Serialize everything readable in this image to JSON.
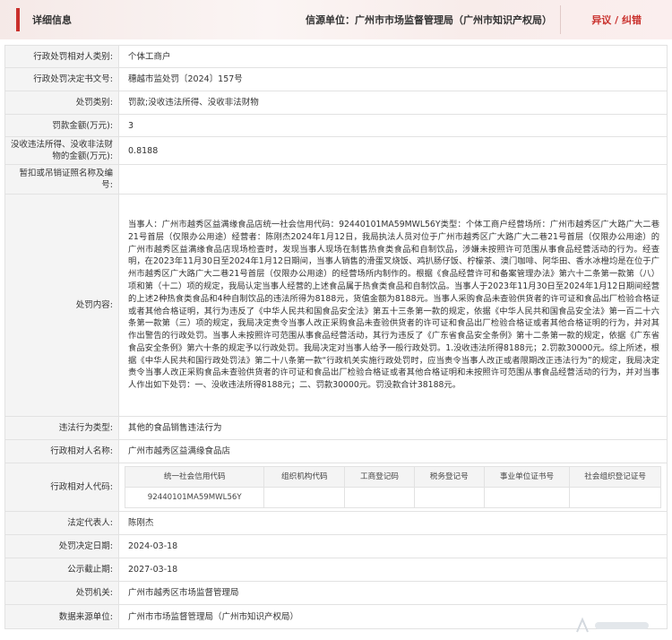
{
  "header": {
    "title": "详细信息",
    "source_prefix": "信源单位：",
    "source_unit": "广州市市场监督管理局（广州市知识产权局）",
    "objection": "异议 / 纠错"
  },
  "rows": {
    "party_type": {
      "label": "行政处罚相对人类别:",
      "value": "个体工商户"
    },
    "doc_no": {
      "label": "行政处罚决定书文号:",
      "value": "穗越市监处罚〔2024〕157号"
    },
    "penalty_type": {
      "label": "处罚类别:",
      "value": "罚款;没收违法所得、没收非法财物"
    },
    "fine": {
      "label": "罚款金额(万元):",
      "value": "3"
    },
    "confiscation": {
      "label": "没收违法所得、没收非法财物的金额(万元):",
      "value": "0.8188"
    },
    "license": {
      "label": "暂扣或吊销证照名称及编号:",
      "value": ""
    },
    "content": {
      "label": "处罚内容:",
      "value": "当事人：广州市越秀区益满缘食品店统一社会信用代码：92440101MA59MWL56Y类型：个体工商户经营场所：广州市越秀区广大路广大二巷21号首层（仅限办公用途）经营者：陈刚杰2024年1月12日，我局执法人员对位于广州市越秀区广大路广大二巷21号首层（仅限办公用途）的广州市越秀区益满缘食品店现场检查时，发现当事人现场在制售热食类食品和自制饮品，涉嫌未按照许可范围从事食品经营活动的行为。经查明，在2023年11月30日至2024年1月12日期间，当事人销售的滑蛋叉烧饭、鸡扒肠仔饭、柠檬茶、澳门咖啡、阿华田、香水冰橙均是在位于广州市越秀区广大路广大二巷21号首层（仅限办公用途）的经营场所内制作的。根据《食品经营许可和备案管理办法》第六十二条第一款第（八）项和第（十二）项的规定，我局认定当事人经营的上述食品属于热食类食品和自制饮品。当事人于2023年11月30日至2024年1月12日期间经营的上述2种热食类食品和4种自制饮品的违法所得为8188元，货值金额为8188元。当事人采购食品未查验供货者的许可证和食品出厂检验合格证或者其他合格证明，其行为违反了《中华人民共和国食品安全法》第五十三条第一款的规定，依据《中华人民共和国食品安全法》第一百二十六条第一款第（三）项的规定，我局决定责令当事人改正采购食品未查验供货者的许可证和食品出厂检验合格证或者其他合格证明的行为，并对其作出警告的行政处罚。当事人未按照许可范围从事食品经营活动，其行为违反了《广东省食品安全条例》第十二条第一款的规定，依据《广东省食品安全条例》第六十条的规定予以行政处罚。我局决定对当事人给予一般行政处罚。1.没收违法所得8188元；2.罚款30000元。综上所述，根据《中华人民共和国行政处罚法》第二十八条第一款“行政机关实施行政处罚时，应当责令当事人改正或者限期改正违法行为”的规定，我局决定责令当事人改正采购食品未查验供货者的许可证和食品出厂检验合格证或者其他合格证明和未按照许可范围从事食品经营活动的行为，并对当事人作出如下处罚：一、没收违法所得8188元；二、罚款30000元。罚没款合计38188元。"
    },
    "violation": {
      "label": "违法行为类型:",
      "value": "其他的食品销售违法行为"
    },
    "party_name": {
      "label": "行政相对人名称:",
      "value": "广州市越秀区益满缘食品店"
    },
    "party_code": {
      "label": "行政相对人代码:",
      "headers": [
        "统一社会信用代码",
        "组织机构代码",
        "工商登记码",
        "税务登记号",
        "事业单位证书号",
        "社会组织登记证号"
      ],
      "values": [
        "92440101MA59MWL56Y",
        "",
        "",
        "",
        "",
        ""
      ]
    },
    "legal_rep": {
      "label": "法定代表人:",
      "value": "陈刚杰"
    },
    "decision_date": {
      "label": "处罚决定日期:",
      "value": "2024-03-18"
    },
    "publicity_end": {
      "label": "公示截止期:",
      "value": "2027-03-18"
    },
    "authority": {
      "label": "处罚机关:",
      "value": "广州市越秀区市场监督管理局"
    },
    "data_source": {
      "label": "数据来源单位:",
      "value": "广州市市场监督管理局（广州市知识产权局）"
    }
  },
  "colors": {
    "accent": "#c9302c",
    "label_bg": "#f4f4f4",
    "border": "#e2e2e2"
  }
}
